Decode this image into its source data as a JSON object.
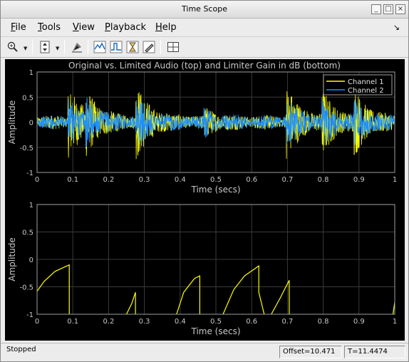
{
  "window": {
    "title": "Time Scope"
  },
  "menu": [
    {
      "accel": "F",
      "rest": "ile"
    },
    {
      "accel": "T",
      "rest": "ools"
    },
    {
      "accel": "V",
      "rest": "iew"
    },
    {
      "accel": "P",
      "rest": "layback"
    },
    {
      "accel": "H",
      "rest": "elp"
    }
  ],
  "toolbar": {
    "icons": [
      "zoom-in-icon",
      "zoom-y-icon",
      "highlight-icon",
      "triggers-icon",
      "cursor-measurements-icon",
      "signal-statistics-icon",
      "peak-finder-icon",
      "style-icon",
      "layout-icon"
    ]
  },
  "scope": {
    "title": "Original vs. Limited Audio (top) and Limiter Gain in dB (bottom)",
    "colors": {
      "channel1": "#ffff00",
      "channel2": "#1e90ff",
      "axis_bg": "#000000",
      "grid": "#3a3a3a",
      "tick_text": "#c8c8c8",
      "border": "#a0a0a0"
    },
    "legend": [
      "Channel 1",
      "Channel 2"
    ]
  },
  "chart_data": [
    {
      "type": "line",
      "title": "Original vs. Limited Audio (top) and Limiter Gain in dB (bottom)",
      "xlabel": "Time (secs)",
      "ylabel": "Amplitude",
      "xlim": [
        0,
        1
      ],
      "ylim": [
        -1,
        1
      ],
      "xticks": [
        "0",
        "0.1",
        "0.2",
        "0.3",
        "0.4",
        "0.5",
        "0.6",
        "0.7",
        "0.8",
        "0.9",
        "1"
      ],
      "yticks": [
        "1",
        "0.5",
        "0",
        "-0.5",
        "-1"
      ],
      "grid": true,
      "legend_position": "top-right",
      "series": [
        {
          "name": "Channel 1",
          "color": "#ffff00",
          "bursts": [
            [
              0.09,
              0.62
            ],
            [
              0.14,
              0.42
            ],
            [
              0.28,
              0.62
            ],
            [
              0.47,
              0.18
            ],
            [
              0.7,
              0.62
            ],
            [
              0.8,
              0.5
            ],
            [
              0.89,
              0.5
            ]
          ]
        },
        {
          "name": "Channel 2",
          "color": "#1e90ff",
          "bursts": [
            [
              0.09,
              0.38
            ],
            [
              0.14,
              0.3
            ],
            [
              0.28,
              0.38
            ],
            [
              0.47,
              0.18
            ],
            [
              0.7,
              0.38
            ],
            [
              0.8,
              0.34
            ],
            [
              0.89,
              0.34
            ]
          ]
        }
      ]
    },
    {
      "type": "line",
      "xlabel": "Time (secs)",
      "ylabel": "Amplitude",
      "xlim": [
        0,
        1
      ],
      "ylim": [
        -1,
        1
      ],
      "xticks": [
        "0",
        "0.1",
        "0.2",
        "0.3",
        "0.4",
        "0.5",
        "0.6",
        "0.7",
        "0.8",
        "0.9",
        "1"
      ],
      "yticks": [
        "1",
        "0.5",
        "0",
        "-0.5",
        "-1"
      ],
      "grid": true,
      "series": [
        {
          "color": "#ffff00",
          "segments": [
            [
              [
                0,
                -0.58
              ],
              [
                0.02,
                -0.4
              ],
              [
                0.05,
                -0.22
              ],
              [
                0.09,
                -0.1
              ],
              [
                0.09,
                -1
              ]
            ],
            [
              [
                0.25,
                -1
              ],
              [
                0.265,
                -0.8
              ],
              [
                0.275,
                -0.6
              ],
              [
                0.275,
                -1
              ]
            ],
            [
              [
                0.39,
                -1
              ],
              [
                0.41,
                -0.6
              ],
              [
                0.44,
                -0.35
              ],
              [
                0.455,
                -0.3
              ],
              [
                0.455,
                -1
              ]
            ],
            [
              [
                0.52,
                -1
              ],
              [
                0.55,
                -0.55
              ],
              [
                0.58,
                -0.3
              ],
              [
                0.62,
                -0.12
              ],
              [
                0.62,
                -0.6
              ],
              [
                0.635,
                -1
              ]
            ],
            [
              [
                0.655,
                -1
              ],
              [
                0.68,
                -0.7
              ],
              [
                0.705,
                -0.38
              ],
              [
                0.705,
                -1
              ]
            ],
            [
              [
                0.995,
                -1
              ],
              [
                1.0,
                -0.78
              ]
            ]
          ]
        }
      ]
    }
  ],
  "status": {
    "state": "Stopped",
    "offset": "Offset=10.471",
    "time": "T=11.4474"
  }
}
